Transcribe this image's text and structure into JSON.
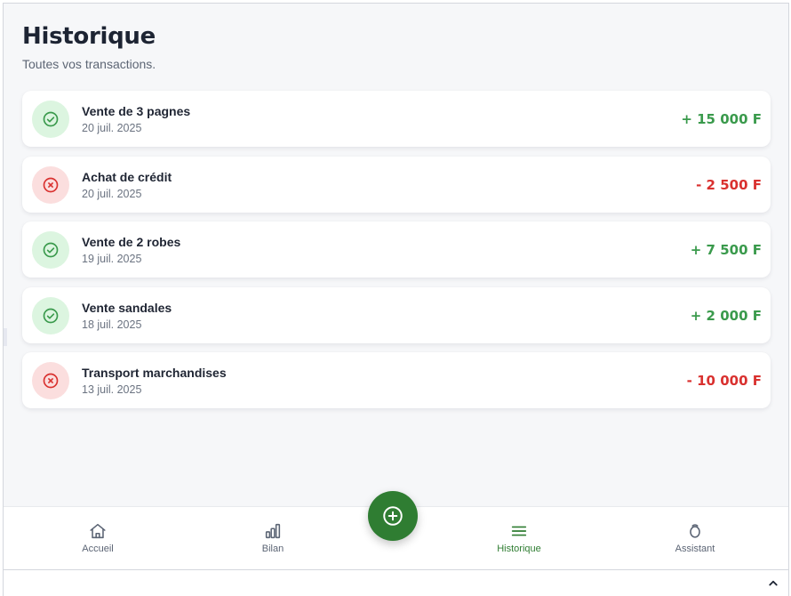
{
  "header": {
    "title": "Historique",
    "subtitle": "Toutes vos transactions."
  },
  "transactions": [
    {
      "title": "Vente de 3 pagnes",
      "date": "20 juil. 2025",
      "amount": "+ 15 000 F",
      "type": "income",
      "icon": "check-circle-icon"
    },
    {
      "title": "Achat de crédit",
      "date": "20 juil. 2025",
      "amount": "- 2 500 F",
      "type": "expense",
      "icon": "x-circle-icon"
    },
    {
      "title": "Vente de 2 robes",
      "date": "19 juil. 2025",
      "amount": "+ 7 500 F",
      "type": "income",
      "icon": "check-circle-icon"
    },
    {
      "title": "Vente sandales",
      "date": "18 juil. 2025",
      "amount": "+ 2 000 F",
      "type": "income",
      "icon": "check-circle-icon"
    },
    {
      "title": "Transport marchandises",
      "date": "13 juil. 2025",
      "amount": "- 10 000 F",
      "type": "expense",
      "icon": "x-circle-icon"
    }
  ],
  "nav": {
    "items": [
      {
        "label": "Accueil",
        "icon": "home-icon",
        "active": false
      },
      {
        "label": "Bilan",
        "icon": "bar-chart-icon",
        "active": false
      },
      {
        "label": "Historique",
        "icon": "menu-lines-icon",
        "active": true
      },
      {
        "label": "Assistant",
        "icon": "ring-icon",
        "active": false
      }
    ],
    "fab_icon": "plus-circle-icon"
  },
  "colors": {
    "primary": "#2f7d32",
    "income": "#3a9a4c",
    "expense": "#d9312f",
    "income_bg": "#dcf5e0",
    "expense_bg": "#fbdede",
    "background": "#f6f7f9"
  }
}
